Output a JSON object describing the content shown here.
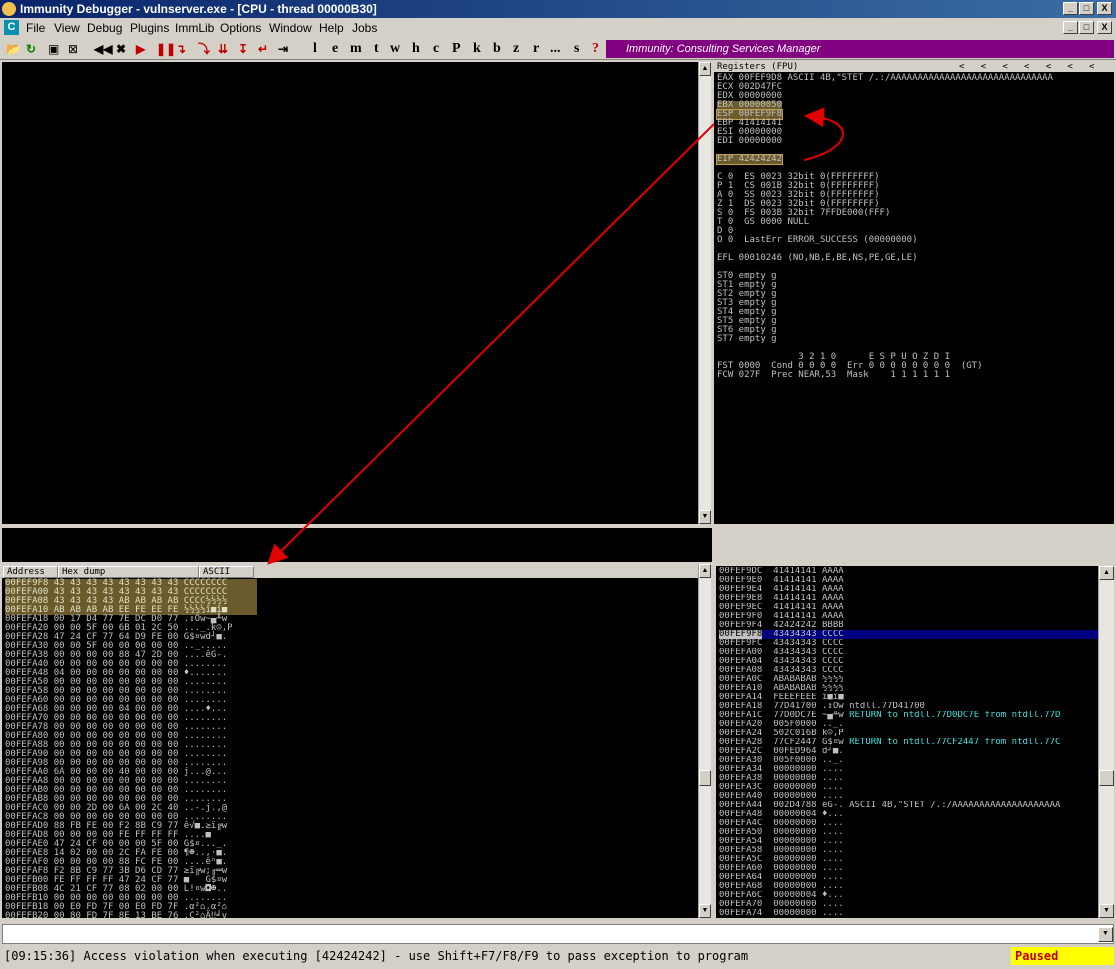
{
  "window": {
    "title": "Immunity Debugger - vulnserver.exe - [CPU - thread 00000B30]",
    "controls": [
      "_",
      "□",
      "X"
    ]
  },
  "menu": {
    "app_icon": "C",
    "items": [
      "File",
      "View",
      "Debug",
      "Plugins",
      "ImmLib",
      "Options",
      "Window",
      "Help",
      "Jobs"
    ]
  },
  "toolbar": {
    "letters": [
      "l",
      "e",
      "m",
      "t",
      "w",
      "h",
      "c",
      "P",
      "k",
      "b",
      "z",
      "r",
      "...",
      "s",
      "?"
    ],
    "banner": "Immunity: Consulting Services Manager"
  },
  "registers": {
    "header": "Registers (FPU)",
    "header_arrows": "<   <   <   <   <   <   <",
    "lines": [
      "EAX 00FEF9D8 ASCII 4B,\"STET /.:/AAAAAAAAAAAAAAAAAAAAAAAAAAAAAA",
      "ECX 002D47FC",
      "EDX 00000000",
      "EBX 00000050",
      "ESP 00FEF9F8",
      "EBP 41414141",
      "ESI 00000000",
      "EDI 00000000",
      "",
      "EIP 42424242",
      "",
      "C 0  ES 0023 32bit 0(FFFFFFFF)",
      "P 1  CS 001B 32bit 0(FFFFFFFF)",
      "A 0  SS 0023 32bit 0(FFFFFFFF)",
      "Z 1  DS 0023 32bit 0(FFFFFFFF)",
      "S 0  FS 003B 32bit 7FFDE000(FFF)",
      "T 0  GS 0000 NULL",
      "D 0",
      "O 0  LastErr ERROR_SUCCESS (00000000)",
      "",
      "EFL 00010246 (NO,NB,E,BE,NS,PE,GE,LE)",
      "",
      "ST0 empty g",
      "ST1 empty g",
      "ST2 empty g",
      "ST3 empty g",
      "ST4 empty g",
      "ST5 empty g",
      "ST6 empty g",
      "ST7 empty g",
      "",
      "               3 2 1 0      E S P U O Z D I",
      "FST 0000  Cond 0 0 0 0  Err 0 0 0 0 0 0 0 0  (GT)",
      "FCW 027F  Prec NEAR,53  Mask    1 1 1 1 1 1"
    ]
  },
  "dump": {
    "columns": [
      "Address",
      "Hex dump",
      "ASCII"
    ],
    "rows": [
      "00FEF9F8 43 43 43 43 43 43 43 43 CCCCCCCC",
      "00FEFA00 43 43 43 43 43 43 43 43 CCCCCCCC",
      "00FEFA08 43 43 43 43 AB AB AB AB CCCC½½½½",
      "00FEFA10 AB AB AB AB EE FE EE FE ½½½½î■î■",
      "00FEFA18 00 17 D4 77 7E DC D0 77 .↕Ôw~▄╨w",
      "00FEFA20 00 00 5F 00 6B 01 2C 50 ..._.k☺,P",
      "00FEFA28 47 24 CF 77 64 D9 FE 00 G$¤wd┘■.",
      "00FEFA30 00 00 5F 00 00 00 00 00 .._.....",
      "00FEFA38 00 00 00 00 88 47 2D 00 ....êG-.",
      "00FEFA40 00 00 00 00 00 00 00 00 ........",
      "00FEFA48 04 00 00 00 00 00 00 00 ♦.......",
      "00FEFA50 00 00 00 00 00 00 00 00 ........",
      "00FEFA58 00 00 00 00 00 00 00 00 ........",
      "00FEFA60 00 00 00 00 00 00 00 00 ........",
      "00FEFA68 00 00 00 00 04 00 00 00 ....♦...",
      "00FEFA70 00 00 00 00 00 00 00 00 ........",
      "00FEFA78 00 00 00 00 00 00 00 00 ........",
      "00FEFA80 00 00 00 00 00 00 00 00 ........",
      "00FEFA88 00 00 00 00 00 00 00 00 ........",
      "00FEFA90 00 00 00 00 00 00 00 00 ........",
      "00FEFA98 00 00 00 00 00 00 00 00 ........",
      "00FEFAA0 6A 00 00 00 40 00 00 00 j...@...",
      "00FEFAA8 00 00 00 00 00 00 00 00 ........",
      "00FEFAB0 00 00 00 00 00 00 00 00 ........",
      "00FEFAB8 00 00 00 00 00 00 00 00 ........",
      "00FEFAC0 00 00 2D 00 6A 00 2C 40 ..-.j.,@",
      "00FEFAC8 00 00 00 00 00 00 00 00 ........",
      "00FEFAD0 88 FB FE 00 F2 8B C9 77 ê√■.≥ï╔w",
      "00FEFAD8 00 00 00 00 FE FF FF FF ....■   ",
      "00FEFAE0 47 24 CF 00 00 00 5F 00 G$¤..._.",
      "00FEFAE8 14 02 00 00 2C FA FE 00 ¶☻..,·■.",
      "00FEFAF0 00 00 00 00 88 FC FE 00 ....êⁿ■.",
      "00FEFAF8 F2 8B C9 77 3B D6 CD 77 ≥ï╔w;╓═w",
      "00FEFB00 FE FF FF FF 47 24 CF 77 ■   G$¤w",
      "00FEFB08 4C 21 CF 77 08 02 00 00 L!¤w◘☻..",
      "00FEFB10 00 00 00 00 00 00 00 00 ........",
      "00FEFB18 00 E0 FD 7F 00 E0 FD 7F .α²⌂.α²⌂",
      "00FEFB20 00 80 FD 7F 8E 13 BE 76 .Ç²⌂Ä‼╛v"
    ]
  },
  "stack": {
    "rows": [
      {
        "addr": "00FEF9DC",
        "val": "41414141",
        "ascii": "AAAA",
        "comment": ""
      },
      {
        "addr": "00FEF9E0",
        "val": "41414141",
        "ascii": "AAAA",
        "comment": ""
      },
      {
        "addr": "00FEF9E4",
        "val": "41414141",
        "ascii": "AAAA",
        "comment": ""
      },
      {
        "addr": "00FEF9E8",
        "val": "41414141",
        "ascii": "AAAA",
        "comment": ""
      },
      {
        "addr": "00FEF9EC",
        "val": "41414141",
        "ascii": "AAAA",
        "comment": ""
      },
      {
        "addr": "00FEF9F0",
        "val": "41414141",
        "ascii": "AAAA",
        "comment": ""
      },
      {
        "addr": "00FEF9F4",
        "val": "42424242",
        "ascii": "BBBB",
        "comment": ""
      },
      {
        "addr": "00FEF9F8",
        "val": "43434343",
        "ascii": "CCCC",
        "comment": ""
      },
      {
        "addr": "00FEF9FC",
        "val": "43434343",
        "ascii": "CCCC",
        "comment": ""
      },
      {
        "addr": "00FEFA00",
        "val": "43434343",
        "ascii": "CCCC",
        "comment": ""
      },
      {
        "addr": "00FEFA04",
        "val": "43434343",
        "ascii": "CCCC",
        "comment": ""
      },
      {
        "addr": "00FEFA08",
        "val": "43434343",
        "ascii": "CCCC",
        "comment": ""
      },
      {
        "addr": "00FEFA0C",
        "val": "ABABABAB",
        "ascii": "½½½½",
        "comment": ""
      },
      {
        "addr": "00FEFA10",
        "val": "ABABABAB",
        "ascii": "½½½½",
        "comment": ""
      },
      {
        "addr": "00FEFA14",
        "val": "FEEEFEEE",
        "ascii": "î■î■",
        "comment": ""
      },
      {
        "addr": "00FEFA18",
        "val": "77D41700",
        "ascii": ".↕Ôw",
        "comment": "ntdll.77D41700"
      },
      {
        "addr": "00FEFA1C",
        "val": "77D0DC7E",
        "ascii": "~▄╨w",
        "comment": "RETURN to ntdll.77D0DC7E from ntdll.77D"
      },
      {
        "addr": "00FEFA20",
        "val": "005F0000",
        "ascii": ".._.",
        "comment": ""
      },
      {
        "addr": "00FEFA24",
        "val": "502C016B",
        "ascii": "k☺,P",
        "comment": ""
      },
      {
        "addr": "00FEFA28",
        "val": "77CF2447",
        "ascii": "G$¤w",
        "comment": "RETURN to ntdll.77CF2447 from ntdll.77C"
      },
      {
        "addr": "00FEFA2C",
        "val": "00FED964",
        "ascii": "d┘■.",
        "comment": ""
      },
      {
        "addr": "00FEFA30",
        "val": "005F0000",
        "ascii": ".._.",
        "comment": ""
      },
      {
        "addr": "00FEFA34",
        "val": "00000000",
        "ascii": "....",
        "comment": ""
      },
      {
        "addr": "00FEFA38",
        "val": "00000000",
        "ascii": "....",
        "comment": ""
      },
      {
        "addr": "00FEFA3C",
        "val": "00000000",
        "ascii": "....",
        "comment": ""
      },
      {
        "addr": "00FEFA40",
        "val": "00000000",
        "ascii": "....",
        "comment": ""
      },
      {
        "addr": "00FEFA44",
        "val": "002D4788",
        "ascii": "êG-.",
        "comment": "ASCII 4B,\"STET /.:/AAAAAAAAAAAAAAAAAAAA"
      },
      {
        "addr": "00FEFA48",
        "val": "00000004",
        "ascii": "♦...",
        "comment": ""
      },
      {
        "addr": "00FEFA4C",
        "val": "00000000",
        "ascii": "....",
        "comment": ""
      },
      {
        "addr": "00FEFA50",
        "val": "00000000",
        "ascii": "....",
        "comment": ""
      },
      {
        "addr": "00FEFA54",
        "val": "00000000",
        "ascii": "....",
        "comment": ""
      },
      {
        "addr": "00FEFA58",
        "val": "00000000",
        "ascii": "....",
        "comment": ""
      },
      {
        "addr": "00FEFA5C",
        "val": "00000000",
        "ascii": "....",
        "comment": ""
      },
      {
        "addr": "00FEFA60",
        "val": "00000000",
        "ascii": "....",
        "comment": ""
      },
      {
        "addr": "00FEFA64",
        "val": "00000000",
        "ascii": "....",
        "comment": ""
      },
      {
        "addr": "00FEFA68",
        "val": "00000000",
        "ascii": "....",
        "comment": ""
      },
      {
        "addr": "00FEFA6C",
        "val": "00000004",
        "ascii": "♦...",
        "comment": ""
      },
      {
        "addr": "00FEFA70",
        "val": "00000000",
        "ascii": "....",
        "comment": ""
      },
      {
        "addr": "00FEFA74",
        "val": "00000000",
        "ascii": "....",
        "comment": ""
      }
    ],
    "selected_index": 7
  },
  "status": {
    "message": "[09:15:36] Access violation when executing [42424242] - use Shift+F7/F8/F9 to pass exception to program",
    "state": "Paused"
  },
  "colors": {
    "highlight": "#6b5b2c",
    "selection": "#00007f",
    "annotation_arrow": "#e00000",
    "banner": "#800080",
    "paused_bg": "#ffff00",
    "paused_fg": "#c00000"
  }
}
